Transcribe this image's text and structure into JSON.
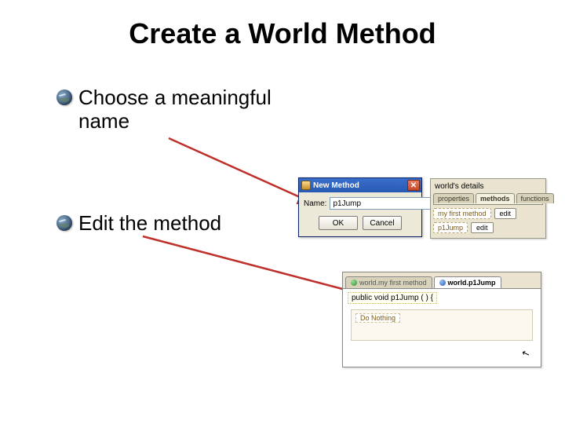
{
  "title": "Create a World Method",
  "bullets": {
    "one": "Choose a meaningful name",
    "two": "Edit the method"
  },
  "dialog": {
    "title": "New Method",
    "name_label": "Name:",
    "name_value": "p1Jump",
    "ok": "OK",
    "cancel": "Cancel",
    "close_glyph": "✕"
  },
  "details": {
    "heading": "world's details",
    "tabs": {
      "properties": "properties",
      "methods": "methods",
      "functions": "functions"
    },
    "rows": [
      {
        "name": "my first method",
        "action": "edit"
      },
      {
        "name": "p1Jump",
        "action": "edit"
      }
    ]
  },
  "editor": {
    "tabs": {
      "inactive": "world.my first method",
      "active": "world.p1Jump"
    },
    "signature": "public void p1Jump ( ) {",
    "inner": "Do Nothing",
    "cursor": "↖"
  }
}
